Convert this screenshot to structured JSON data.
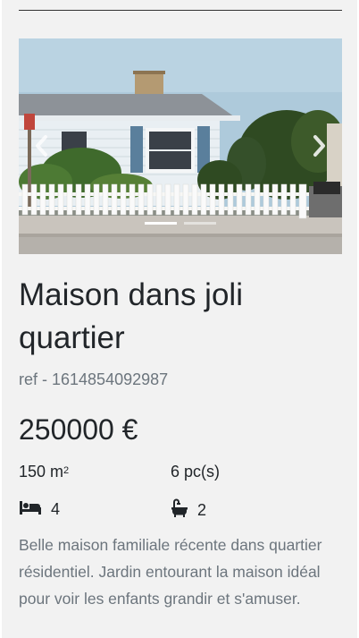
{
  "listing": {
    "title": "Maison dans joli quartier",
    "ref": "ref - 1614854092987",
    "price": "250000 €",
    "surface_value": "150 m",
    "surface_unit_sup": "2",
    "rooms": "6 pc(s)",
    "bedrooms": "4",
    "bathrooms": "2",
    "description": "Belle maison familiale récente dans quartier résidentiel. Jardin entourant la maison idéal pour voir les enfants grandir et s'amuser."
  },
  "carousel": {
    "slide_count": 2,
    "active_index": 0
  },
  "icons": {
    "prev": "chevron-left-icon",
    "next": "chevron-right-icon",
    "bed": "bed-icon",
    "bath": "bathtub-icon"
  },
  "colors": {
    "text": "#212529",
    "muted": "#6c757d",
    "card_bg": "#f2f2f2"
  }
}
